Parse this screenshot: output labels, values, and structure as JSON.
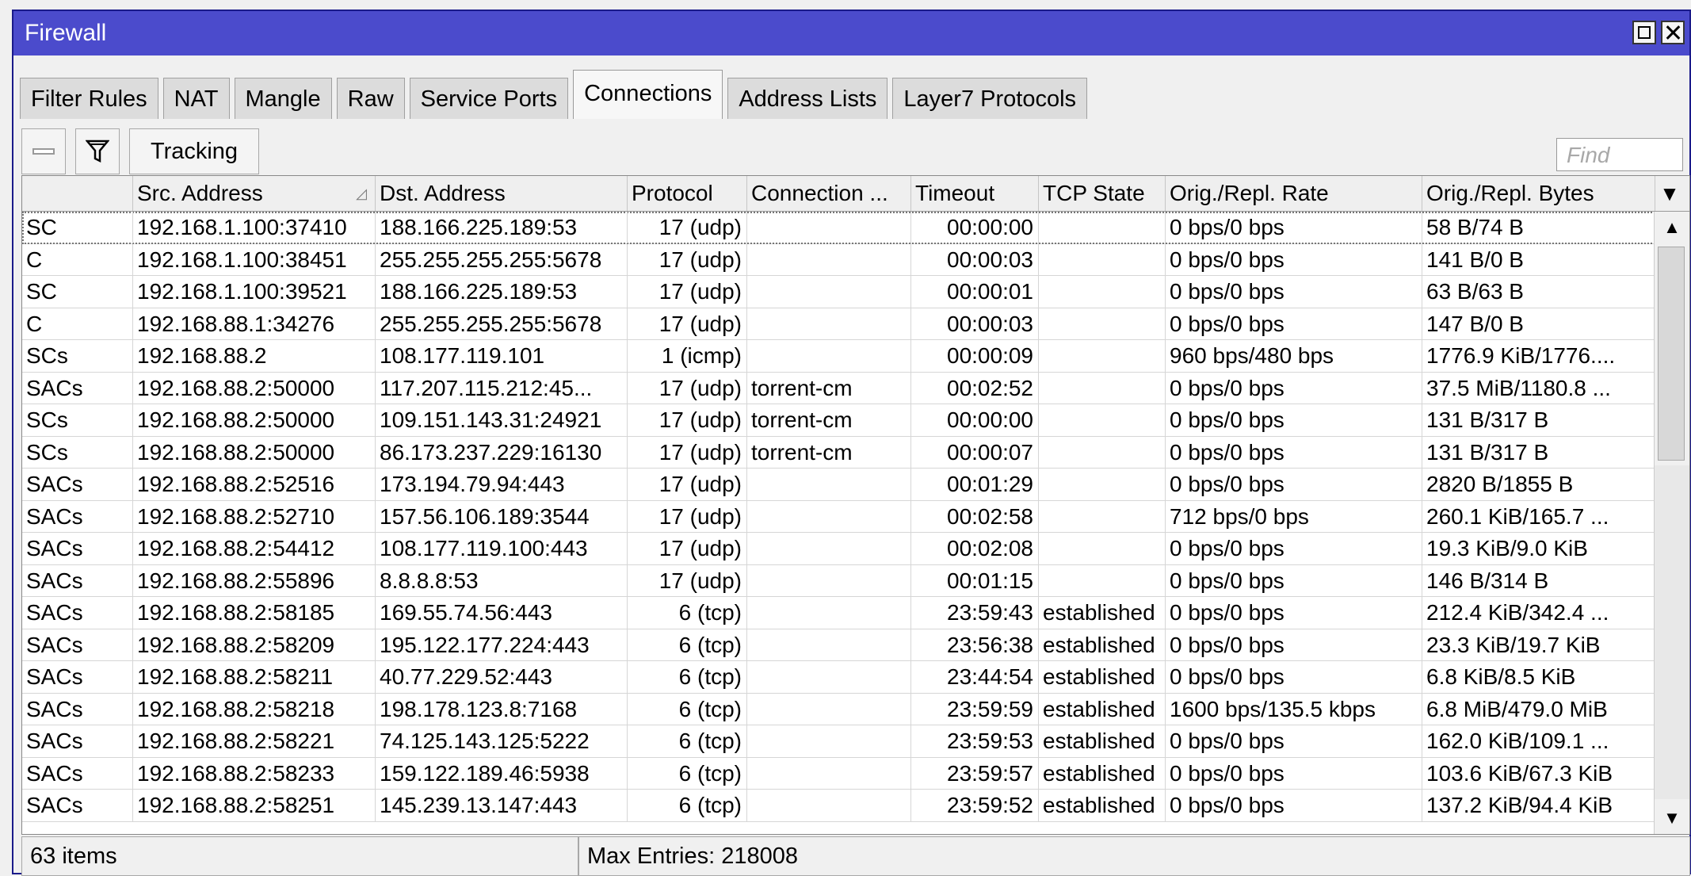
{
  "window": {
    "title": "Firewall"
  },
  "tabs": [
    {
      "label": "Filter Rules",
      "active": false
    },
    {
      "label": "NAT",
      "active": false
    },
    {
      "label": "Mangle",
      "active": false
    },
    {
      "label": "Raw",
      "active": false
    },
    {
      "label": "Service Ports",
      "active": false
    },
    {
      "label": "Connections",
      "active": true
    },
    {
      "label": "Address Lists",
      "active": false
    },
    {
      "label": "Layer7 Protocols",
      "active": false
    }
  ],
  "toolbar": {
    "remove_icon": "minus-icon",
    "filter_icon": "filter-icon",
    "tracking_label": "Tracking",
    "find_placeholder": "Find"
  },
  "table": {
    "columns": [
      "",
      "Src. Address",
      "Dst. Address",
      "Protocol",
      "Connection ...",
      "Timeout",
      "TCP State",
      "Orig./Repl. Rate",
      "Orig./Repl. Bytes"
    ],
    "sorted_column": "Src. Address",
    "rows": [
      [
        "SC",
        "192.168.1.100:37410",
        "188.166.225.189:53",
        "17 (udp)",
        "",
        "00:00:00",
        "",
        "0 bps/0 bps",
        "58 B/74 B"
      ],
      [
        "C",
        "192.168.1.100:38451",
        "255.255.255.255:5678",
        "17 (udp)",
        "",
        "00:00:03",
        "",
        "0 bps/0 bps",
        "141 B/0 B"
      ],
      [
        "SC",
        "192.168.1.100:39521",
        "188.166.225.189:53",
        "17 (udp)",
        "",
        "00:00:01",
        "",
        "0 bps/0 bps",
        "63 B/63 B"
      ],
      [
        "C",
        "192.168.88.1:34276",
        "255.255.255.255:5678",
        "17 (udp)",
        "",
        "00:00:03",
        "",
        "0 bps/0 bps",
        "147 B/0 B"
      ],
      [
        "SCs",
        "192.168.88.2",
        "108.177.119.101",
        "1 (icmp)",
        "",
        "00:00:09",
        "",
        "960 bps/480 bps",
        "1776.9 KiB/1776...."
      ],
      [
        "SACs",
        "192.168.88.2:50000",
        "117.207.115.212:45...",
        "17 (udp)",
        "torrent-cm",
        "00:02:52",
        "",
        "0 bps/0 bps",
        "37.5 MiB/1180.8 ..."
      ],
      [
        "SCs",
        "192.168.88.2:50000",
        "109.151.143.31:24921",
        "17 (udp)",
        "torrent-cm",
        "00:00:00",
        "",
        "0 bps/0 bps",
        "131 B/317 B"
      ],
      [
        "SCs",
        "192.168.88.2:50000",
        "86.173.237.229:16130",
        "17 (udp)",
        "torrent-cm",
        "00:00:07",
        "",
        "0 bps/0 bps",
        "131 B/317 B"
      ],
      [
        "SACs",
        "192.168.88.2:52516",
        "173.194.79.94:443",
        "17 (udp)",
        "",
        "00:01:29",
        "",
        "0 bps/0 bps",
        "2820 B/1855 B"
      ],
      [
        "SACs",
        "192.168.88.2:52710",
        "157.56.106.189:3544",
        "17 (udp)",
        "",
        "00:02:58",
        "",
        "712 bps/0 bps",
        "260.1 KiB/165.7 ..."
      ],
      [
        "SACs",
        "192.168.88.2:54412",
        "108.177.119.100:443",
        "17 (udp)",
        "",
        "00:02:08",
        "",
        "0 bps/0 bps",
        "19.3 KiB/9.0 KiB"
      ],
      [
        "SACs",
        "192.168.88.2:55896",
        "8.8.8.8:53",
        "17 (udp)",
        "",
        "00:01:15",
        "",
        "0 bps/0 bps",
        "146 B/314 B"
      ],
      [
        "SACs",
        "192.168.88.2:58185",
        "169.55.74.56:443",
        "6 (tcp)",
        "",
        "23:59:43",
        "established",
        "0 bps/0 bps",
        "212.4 KiB/342.4 ..."
      ],
      [
        "SACs",
        "192.168.88.2:58209",
        "195.122.177.224:443",
        "6 (tcp)",
        "",
        "23:56:38",
        "established",
        "0 bps/0 bps",
        "23.3 KiB/19.7 KiB"
      ],
      [
        "SACs",
        "192.168.88.2:58211",
        "40.77.229.52:443",
        "6 (tcp)",
        "",
        "23:44:54",
        "established",
        "0 bps/0 bps",
        "6.8 KiB/8.5 KiB"
      ],
      [
        "SACs",
        "192.168.88.2:58218",
        "198.178.123.8:7168",
        "6 (tcp)",
        "",
        "23:59:59",
        "established",
        "1600 bps/135.5 kbps",
        "6.8 MiB/479.0 MiB"
      ],
      [
        "SACs",
        "192.168.88.2:58221",
        "74.125.143.125:5222",
        "6 (tcp)",
        "",
        "23:59:53",
        "established",
        "0 bps/0 bps",
        "162.0 KiB/109.1 ..."
      ],
      [
        "SACs",
        "192.168.88.2:58233",
        "159.122.189.46:5938",
        "6 (tcp)",
        "",
        "23:59:57",
        "established",
        "0 bps/0 bps",
        "103.6 KiB/67.3 KiB"
      ],
      [
        "SACs",
        "192.168.88.2:58251",
        "145.239.13.147:443",
        "6 (tcp)",
        "",
        "23:59:52",
        "established",
        "0 bps/0 bps",
        "137.2 KiB/94.4 KiB"
      ]
    ]
  },
  "status": {
    "items": "63 items",
    "max_entries": "Max Entries: 218008"
  },
  "colors": {
    "titlebar": "#4b4bcc",
    "window_bg": "#f0f0f0"
  }
}
